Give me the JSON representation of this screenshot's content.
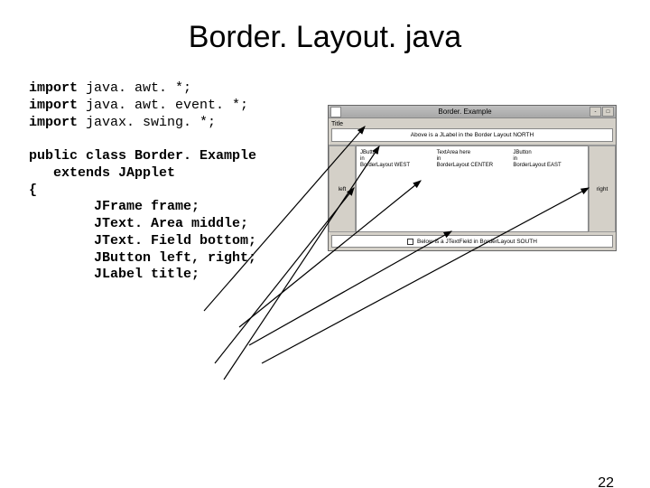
{
  "slide": {
    "title": "Border. Layout. java",
    "page_number": "22"
  },
  "code": {
    "l1a": "import ",
    "l1b": "java. awt. *;",
    "l2a": "import ",
    "l2b": "java. awt. event. *;",
    "l3a": "import ",
    "l3b": "javax. swing. *;",
    "l4": "public class Border. Example",
    "l5": "   extends JApplet",
    "l6": "{",
    "l7": "        JFrame frame;",
    "l8": "        JText. Area middle;",
    "l9": "        JText. Field bottom;",
    "l10": "        JButton left, right;",
    "l11": "        JLabel title;"
  },
  "applet": {
    "window_title": "Border. Example",
    "north_label": "Title",
    "north_text": "Above is a JLabel in the Border Layout NORTH",
    "west_button": "left",
    "east_button": "right",
    "center_col1_a": "JButton",
    "center_col1_b": "in",
    "center_col1_c": "BorderLayout WEST",
    "center_col2_a": "TextArea here",
    "center_col2_b": "in",
    "center_col2_c": "BorderLayout CENTER",
    "center_col3_a": "JButton",
    "center_col3_b": "in",
    "center_col3_c": "BorderLayout EAST",
    "south_text": "Below is a JTextField in BorderLayout SOUTH"
  }
}
